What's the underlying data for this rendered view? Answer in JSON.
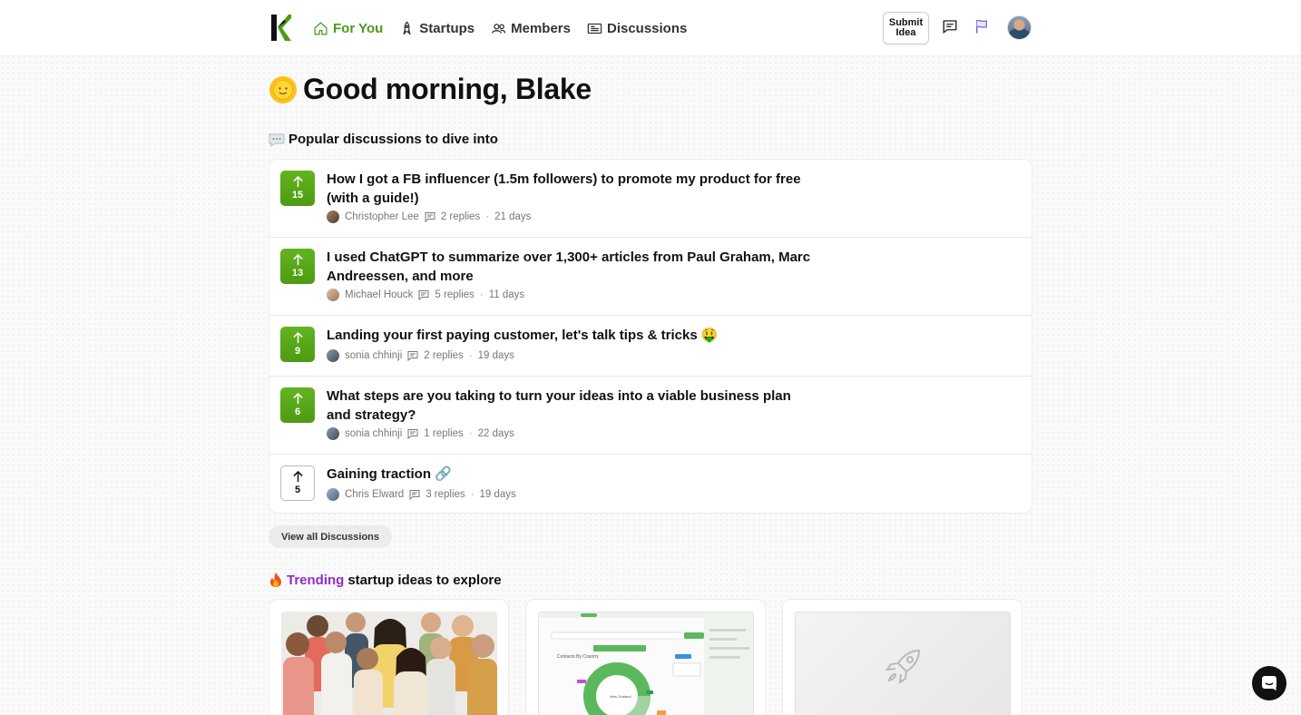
{
  "header": {
    "logo": "K",
    "nav": [
      {
        "label": "For You",
        "icon": "home-icon",
        "active": true
      },
      {
        "label": "Startups",
        "icon": "rocket-icon",
        "active": false
      },
      {
        "label": "Members",
        "icon": "users-icon",
        "active": false
      },
      {
        "label": "Discussions",
        "icon": "newspaper-icon",
        "active": false
      }
    ],
    "submit_label": "Submit\nIdea",
    "icons": [
      "message-icon",
      "flag-icon",
      "avatar"
    ]
  },
  "greeting": {
    "emoji": "sun-face-icon",
    "text": "Good morning, Blake"
  },
  "discussions": {
    "heading": "Popular discussions to dive into",
    "items": [
      {
        "votes": "15",
        "title": "How I got a FB influencer (1.5m followers) to promote my product for free (with a guide!)",
        "author": "Christopher Lee",
        "replies": "2 replies",
        "age": "21 days",
        "voted": true
      },
      {
        "votes": "13",
        "title": "I used ChatGPT to summarize over 1,300+ articles from Paul Graham, Marc Andreessen, and more",
        "author": "Michael Houck",
        "replies": "5 replies",
        "age": "11 days",
        "voted": true
      },
      {
        "votes": "9",
        "title": "Landing your first paying customer, let's talk tips & tricks 🤑",
        "author": "sonia chhinji",
        "replies": "2 replies",
        "age": "19 days",
        "voted": true
      },
      {
        "votes": "6",
        "title": "What steps are you taking to turn your ideas into a viable business plan and strategy?",
        "author": "sonia chhinji",
        "replies": "1 replies",
        "age": "22 days",
        "voted": true
      },
      {
        "votes": "5",
        "title": "Gaining traction 🔗",
        "author": "Chris Elward",
        "replies": "3 replies",
        "age": "19 days",
        "voted": false
      }
    ],
    "view_all": "View all Discussions"
  },
  "trending": {
    "heading_highlight": "Trending",
    "heading_rest": "startup ideas to explore",
    "chart_preview": {
      "title": "Contacts By Country",
      "center_label": "New Zealand"
    }
  },
  "colors": {
    "accent_green": "#4a9a1c",
    "vote_green": "#5aab19",
    "trending_purple": "#8b2fd0"
  }
}
